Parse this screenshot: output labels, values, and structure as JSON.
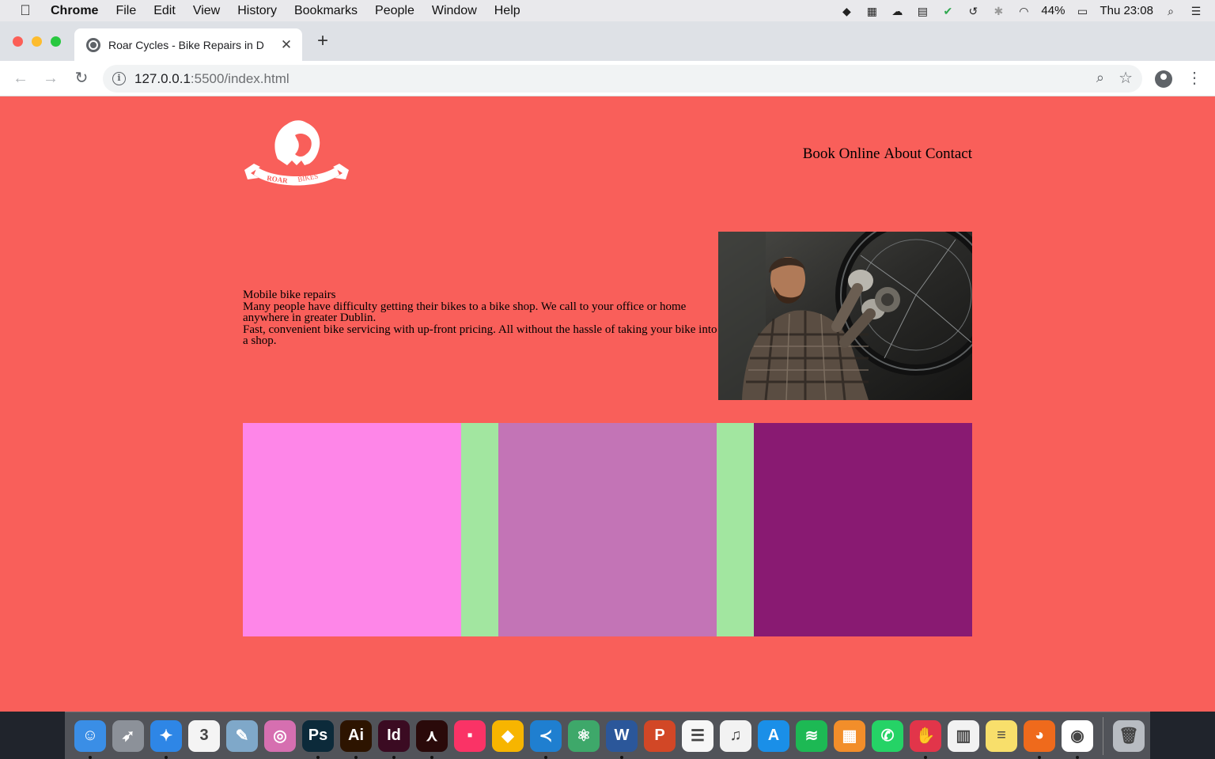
{
  "menubar": {
    "app": "Chrome",
    "items": [
      "File",
      "Edit",
      "View",
      "History",
      "Bookmarks",
      "People",
      "Window",
      "Help"
    ],
    "battery": "44%",
    "clock": "Thu 23:08"
  },
  "browser": {
    "tab_title": "Roar Cycles - Bike Repairs in D",
    "url_host": "127.0.0.1",
    "url_rest": ":5500/index.html"
  },
  "page": {
    "logo_text": [
      "ROAR",
      "BIKES"
    ],
    "nav": [
      "Book Online",
      "About",
      "Contact"
    ],
    "hero": {
      "heading": "Mobile bike repairs",
      "paragraph1": "Many people have difficulty getting their bikes to a bike shop. We call to your office or home anywhere in greater Dublin.",
      "paragraph2": "Fast, convenient bike servicing with up-front pricing. All without the hassle of taking your bike into a shop."
    },
    "background_color": "#f95f5a",
    "block_colors": [
      "#fe86e8",
      "#a2e6a0",
      "#c374b6",
      "#a2e6a0",
      "#891a72"
    ]
  },
  "dock": {
    "apps": [
      {
        "name": "Finder",
        "icon": "finder-icon",
        "glyph": "☺",
        "color": "#3a8ee6",
        "running": true
      },
      {
        "name": "Launchpad",
        "icon": "rocket-icon",
        "glyph": "➶",
        "color": "#8c9199",
        "running": false
      },
      {
        "name": "Safari",
        "icon": "compass-icon",
        "glyph": "✦",
        "color": "#2e86e6",
        "running": true
      },
      {
        "name": "Calendar",
        "icon": "calendar-icon",
        "glyph": "3",
        "color": "#f4f4f4",
        "running": false
      },
      {
        "name": "Preview",
        "icon": "photo-icon",
        "glyph": "✎",
        "color": "#7fa8c9",
        "running": false
      },
      {
        "name": "Color Picker",
        "icon": "color-wheel-icon",
        "glyph": "◎",
        "color": "#d66fb0",
        "running": false
      },
      {
        "name": "Photoshop",
        "icon": "photoshop-icon",
        "glyph": "Ps",
        "color": "#0c2a3a",
        "running": true
      },
      {
        "name": "Illustrator",
        "icon": "illustrator-icon",
        "glyph": "Ai",
        "color": "#2d1400",
        "running": true
      },
      {
        "name": "InDesign",
        "icon": "indesign-icon",
        "glyph": "Id",
        "color": "#3b0b22",
        "running": true
      },
      {
        "name": "Acrobat",
        "icon": "acrobat-icon",
        "glyph": "⋏",
        "color": "#2a0a0a",
        "running": true
      },
      {
        "name": "Invision",
        "icon": "square-icon",
        "glyph": "▪",
        "color": "#fa3366",
        "running": false
      },
      {
        "name": "Sketch",
        "icon": "diamond-icon",
        "glyph": "◆",
        "color": "#f7b500",
        "running": false
      },
      {
        "name": "VS Code",
        "icon": "vscode-icon",
        "glyph": "≺",
        "color": "#1f7fd0",
        "running": true
      },
      {
        "name": "Atom",
        "icon": "atom-icon",
        "glyph": "⚛",
        "color": "#3ea86a",
        "running": false
      },
      {
        "name": "Word",
        "icon": "word-icon",
        "glyph": "W",
        "color": "#2b579a",
        "running": true
      },
      {
        "name": "PowerPoint",
        "icon": "powerpoint-icon",
        "glyph": "P",
        "color": "#d24726",
        "running": false
      },
      {
        "name": "Reminders",
        "icon": "list-icon",
        "glyph": "☰",
        "color": "#f7f7f7",
        "running": false
      },
      {
        "name": "iTunes",
        "icon": "music-icon",
        "glyph": "♫",
        "color": "#f2f2f2",
        "running": false
      },
      {
        "name": "App Store",
        "icon": "appstore-icon",
        "glyph": "A",
        "color": "#1a8fe8",
        "running": false
      },
      {
        "name": "Spotify",
        "icon": "spotify-icon",
        "glyph": "≋",
        "color": "#1db954",
        "running": false
      },
      {
        "name": "Mosaic",
        "icon": "grid-icon",
        "glyph": "▦",
        "color": "#f28e2a",
        "running": false
      },
      {
        "name": "WhatsApp",
        "icon": "whatsapp-icon",
        "glyph": "✆",
        "color": "#25d366",
        "running": false
      },
      {
        "name": "Paw",
        "icon": "paw-icon",
        "glyph": "✋",
        "color": "#e2354a",
        "running": true
      },
      {
        "name": "Numbers",
        "icon": "bar-chart-icon",
        "glyph": "▥",
        "color": "#f2f2f2",
        "running": false
      },
      {
        "name": "Notes",
        "icon": "notes-icon",
        "glyph": "≡",
        "color": "#f8df6b",
        "running": false
      },
      {
        "name": "Firefox",
        "icon": "firefox-icon",
        "glyph": "◕",
        "color": "#ef6a1c",
        "running": true
      },
      {
        "name": "Chrome",
        "icon": "chrome-icon",
        "glyph": "◉",
        "color": "#ffffff",
        "running": true
      },
      {
        "name": "Trash",
        "icon": "trash-icon",
        "glyph": "🗑",
        "color": "#b8bcc2",
        "running": false
      }
    ]
  }
}
